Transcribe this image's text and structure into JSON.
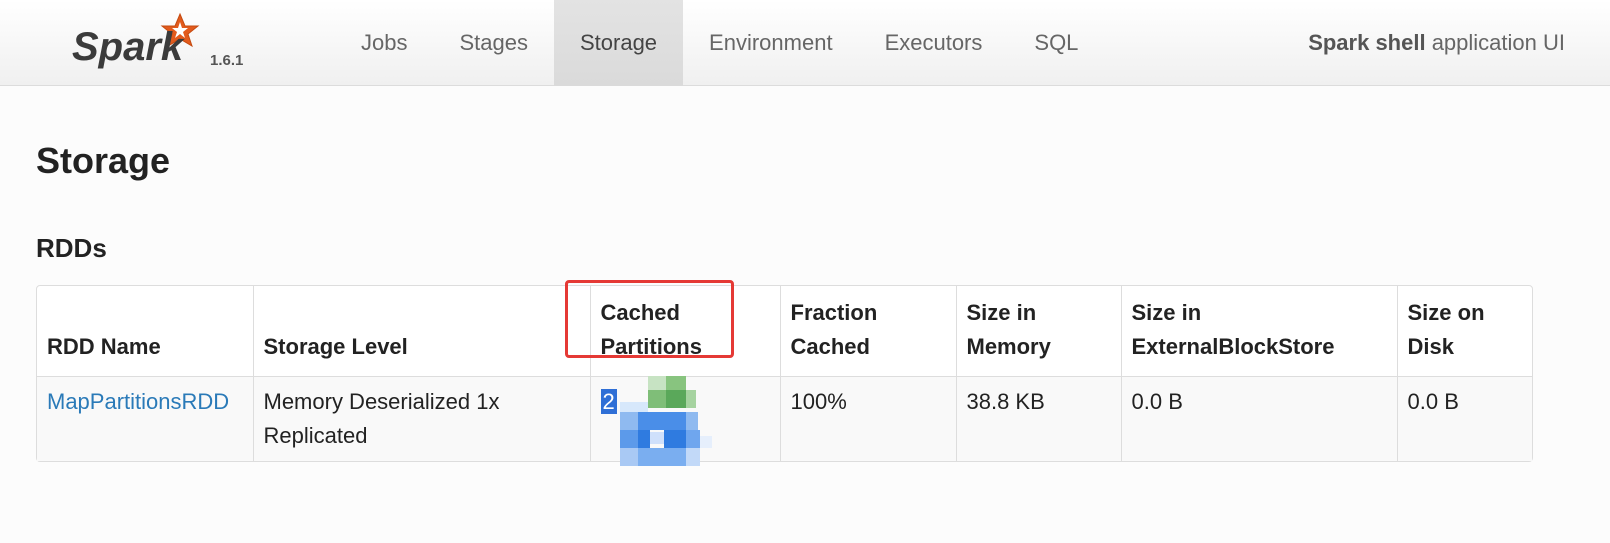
{
  "brand": {
    "logo_text": "Spark",
    "version": "1.6.1"
  },
  "nav": {
    "tabs": [
      {
        "label": "Jobs"
      },
      {
        "label": "Stages"
      },
      {
        "label": "Storage"
      },
      {
        "label": "Environment"
      },
      {
        "label": "Executors"
      },
      {
        "label": "SQL"
      }
    ],
    "active_tab": "Storage"
  },
  "app_title": {
    "strong": "Spark shell",
    "rest": " application UI"
  },
  "page": {
    "title": "Storage",
    "section": "RDDs"
  },
  "table": {
    "headers": {
      "rdd_name": "RDD Name",
      "storage_level": "Storage Level",
      "cached_partitions_1": "Cached",
      "cached_partitions_2": "Partitions",
      "fraction_cached_1": "Fraction",
      "fraction_cached_2": "Cached",
      "size_in_memory_1": "Size in",
      "size_in_memory_2": "Memory",
      "size_external_1": "Size in",
      "size_external_2": "ExternalBlockStore",
      "size_on_disk_1": "Size on",
      "size_on_disk_2": "Disk"
    },
    "rows": [
      {
        "rdd_name": "MapPartitionsRDD",
        "storage_level_1": "Memory Deserialized 1x",
        "storage_level_2": "Replicated",
        "cached_partitions": "2",
        "fraction_cached": "100%",
        "size_in_memory": "38.8 KB",
        "size_external": "0.0 B",
        "size_on_disk": "0.0 B"
      }
    ]
  },
  "colors": {
    "highlight_box": "#e53935",
    "link": "#2a7ab8",
    "selection": "#2f6fd6",
    "logo_star": "#e25a1c"
  }
}
